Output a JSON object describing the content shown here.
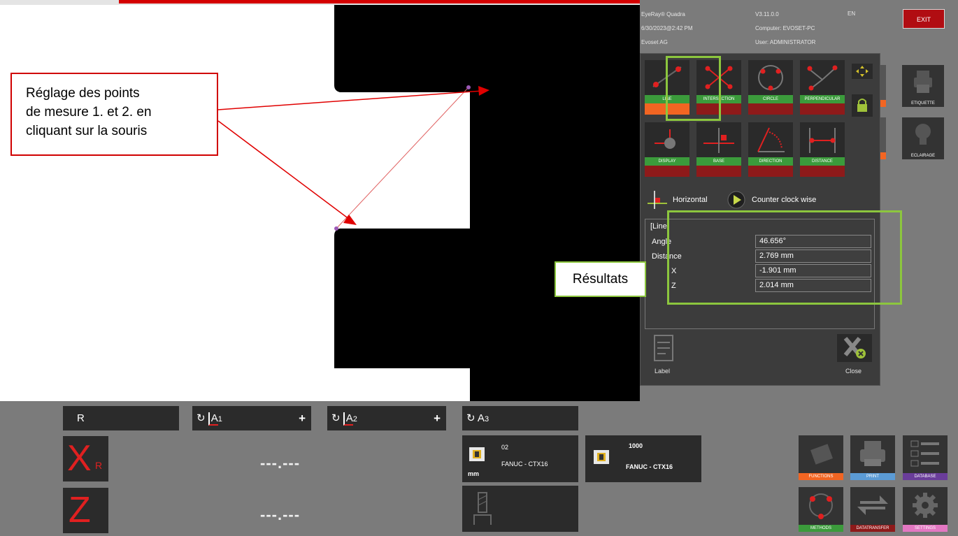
{
  "app": {
    "product": "EyeRay® Quadra",
    "version": "V3.11.0.0",
    "language": "EN",
    "datetime": "6/30/2023@2:42 PM",
    "computer": "Computer: EVOSET-PC",
    "company": "Evoset AG",
    "user": "User: ADMINISTRATOR",
    "exit_label": "EXIT"
  },
  "side_tiles": [
    {
      "label": "ETIQUETTE",
      "color": "#5b9bd5",
      "icon": "printer-icon"
    },
    {
      "label": "ECLAIRAGE",
      "color": "#3b9b3b",
      "icon": "light-bulb-icon"
    }
  ],
  "tools": [
    {
      "label": "LINE",
      "icon": "line-tool-icon",
      "active": true
    },
    {
      "label": "INTERSECTION",
      "icon": "intersection-tool-icon",
      "active": false
    },
    {
      "label": "CIRCLE",
      "icon": "circle-tool-icon",
      "active": false
    },
    {
      "label": "PERPENDICULAR",
      "icon": "perpendicular-tool-icon",
      "active": false
    },
    {
      "label": "DISPLAY",
      "icon": "display-tool-icon",
      "active": false
    },
    {
      "label": "BASE",
      "icon": "base-tool-icon",
      "active": false
    },
    {
      "label": "DIRECTION",
      "icon": "direction-tool-icon",
      "active": false
    },
    {
      "label": "DISTANCE",
      "icon": "distance-tool-icon",
      "active": false
    }
  ],
  "options": {
    "orientation": "Horizontal",
    "rotation": "Counter clock wise"
  },
  "results": {
    "title": "[Line]",
    "rows": [
      {
        "name": "Angle",
        "value": "46.656°"
      },
      {
        "name": "Distance",
        "value": "2.769 mm"
      },
      {
        "name": "X",
        "value": "-1.901 mm"
      },
      {
        "name": "Z",
        "value": "2.014 mm"
      }
    ]
  },
  "panel_buttons": {
    "label": "Label",
    "close": "Close"
  },
  "annotations": {
    "points_callout": "Réglage des points\nde mesure 1. et 2. en\ncliquant sur la souris",
    "results_callout": "Résultats"
  },
  "axes": {
    "r_label": "R",
    "a1_label": "A",
    "a1_sub": "1",
    "a2_label": "A",
    "a2_sub": "2",
    "a3_label": "A",
    "a3_sub": "3",
    "x_label": "X",
    "x_sub": "R",
    "z_label": "Z",
    "x_readout": "---.---",
    "z_readout": "---.---",
    "rotate_glyph": "↻"
  },
  "machines": [
    {
      "id": "02",
      "name": "FANUC - CTX16",
      "unit": "mm"
    },
    {
      "id": "1000",
      "name": "FANUC - CTX16"
    }
  ],
  "function_tiles": [
    {
      "label": "FUNCTIONS",
      "color": "#f26522",
      "icon": "functions-icon"
    },
    {
      "label": "PRINT",
      "color": "#5b9bd5",
      "icon": "printer-icon"
    },
    {
      "label": "DATABASE",
      "color": "#6a3d9a",
      "icon": "database-icon"
    },
    {
      "label": "METHODS",
      "color": "#3b9b3b",
      "icon": "methods-icon"
    },
    {
      "label": "DATATRANSFER",
      "color": "#8e1a1a",
      "icon": "transfer-icon"
    },
    {
      "label": "SETTINGS",
      "color": "#e377c2",
      "icon": "gear-icon"
    }
  ]
}
